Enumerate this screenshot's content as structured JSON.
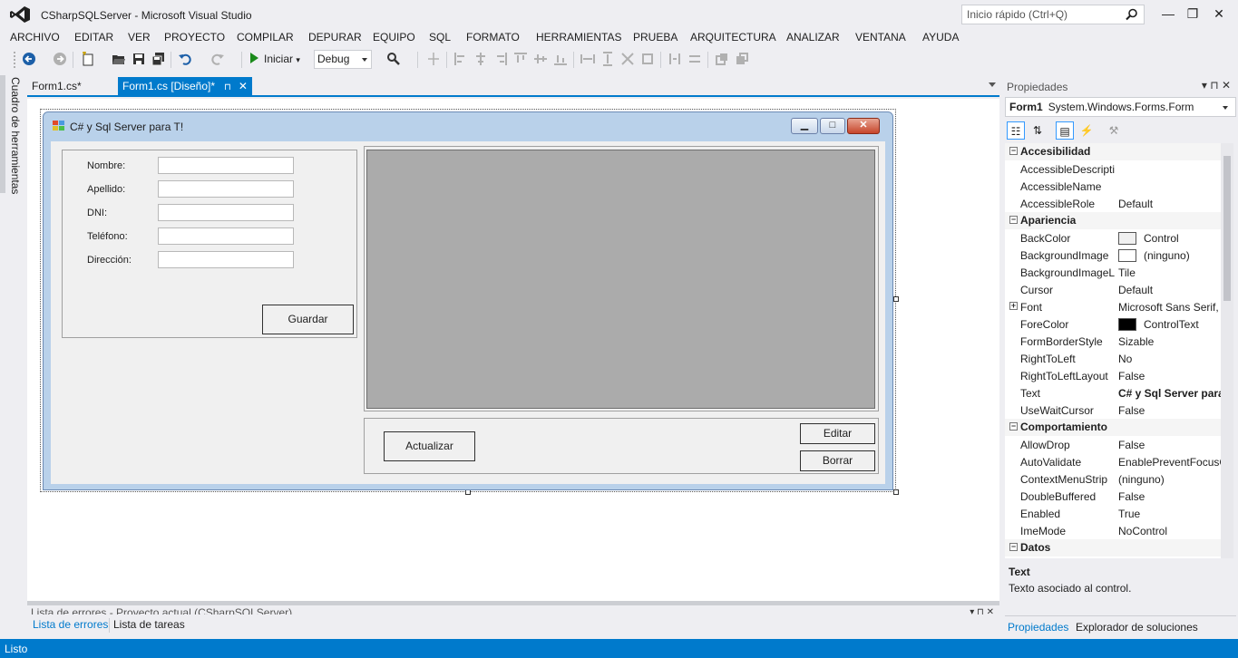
{
  "window": {
    "title": "CSharpSQLServer - Microsoft Visual Studio",
    "quick_launch_placeholder": "Inicio rápido (Ctrl+Q)",
    "minimize_label": "—",
    "restore_label": "❐",
    "close_label": "✕"
  },
  "menu": [
    "ARCHIVO",
    "EDITAR",
    "VER",
    "PROYECTO",
    "COMPILAR",
    "DEPURAR",
    "EQUIPO",
    "SQL",
    "FORMATO",
    "HERRAMIENTAS",
    "PRUEBA",
    "ARQUITECTURA",
    "ANALIZAR",
    "VENTANA",
    "AYUDA"
  ],
  "toolbar": {
    "start_label": "Iniciar",
    "configuration": "Debug"
  },
  "toolbox": {
    "label": "Cuadro de herramientas"
  },
  "doc_tabs": {
    "tab1": "Form1.cs*",
    "tab2": "Form1.cs [Diseño]*",
    "pin": "⊓",
    "close": "✕"
  },
  "form": {
    "title": "C# y Sql Server para T!",
    "min": "▁",
    "max": "□",
    "close": "✕",
    "labels": {
      "nombre": "Nombre:",
      "apellido": "Apellido:",
      "dni": "DNI:",
      "telefono": "Teléfono:",
      "direccion": "Dirección:"
    },
    "buttons": {
      "guardar": "Guardar",
      "actualizar": "Actualizar",
      "editar": "Editar",
      "borrar": "Borrar"
    }
  },
  "bottom_panel": {
    "title": "Lista de errores - Proyecto actual (CSharpSQLServer)",
    "buttons": "▾  ⊓  ✕",
    "tab1": "Lista de errores",
    "tab2": "Lista de tareas"
  },
  "properties": {
    "header": "Propiedades",
    "header_buttons": "▾  ⊓  ✕",
    "object_name": "Form1",
    "object_type": "System.Windows.Forms.Form",
    "rows": [
      {
        "type": "cat",
        "name": "Accesibilidad",
        "exp": "⊟"
      },
      {
        "type": "prop",
        "name": "AccessibleDescription",
        "value": ""
      },
      {
        "type": "prop",
        "name": "AccessibleName",
        "value": ""
      },
      {
        "type": "prop",
        "name": "AccessibleRole",
        "value": "Default"
      },
      {
        "type": "cat",
        "name": "Apariencia",
        "exp": "⊟"
      },
      {
        "type": "prop",
        "name": "BackColor",
        "value": "Control",
        "swatch": "#f0f0f0"
      },
      {
        "type": "prop",
        "name": "BackgroundImage",
        "value": "(ninguno)",
        "swatch": "#ffffff"
      },
      {
        "type": "prop",
        "name": "BackgroundImageLayout",
        "value": "Tile"
      },
      {
        "type": "prop",
        "name": "Cursor",
        "value": "Default"
      },
      {
        "type": "prop",
        "name": "Font",
        "value": "Microsoft Sans Serif,",
        "exp": "⊞"
      },
      {
        "type": "prop",
        "name": "ForeColor",
        "value": "ControlText",
        "swatch": "#000000"
      },
      {
        "type": "prop",
        "name": "FormBorderStyle",
        "value": "Sizable"
      },
      {
        "type": "prop",
        "name": "RightToLeft",
        "value": "No"
      },
      {
        "type": "prop",
        "name": "RightToLeftLayout",
        "value": "False"
      },
      {
        "type": "prop",
        "name": "Text",
        "value": "C# y Sql Server para",
        "bold": true
      },
      {
        "type": "prop",
        "name": "UseWaitCursor",
        "value": "False"
      },
      {
        "type": "cat",
        "name": "Comportamiento",
        "exp": "⊟"
      },
      {
        "type": "prop",
        "name": "AllowDrop",
        "value": "False"
      },
      {
        "type": "prop",
        "name": "AutoValidate",
        "value": "EnablePreventFocusChange"
      },
      {
        "type": "prop",
        "name": "ContextMenuStrip",
        "value": "(ninguno)"
      },
      {
        "type": "prop",
        "name": "DoubleBuffered",
        "value": "False"
      },
      {
        "type": "prop",
        "name": "Enabled",
        "value": "True"
      },
      {
        "type": "prop",
        "name": "ImeMode",
        "value": "NoControl"
      },
      {
        "type": "cat",
        "name": "Datos",
        "exp": "⊟"
      }
    ],
    "description_title": "Text",
    "description_text": "Texto asociado al control.",
    "tab1": "Propiedades",
    "tab2": "Explorador de soluciones"
  },
  "status": {
    "text": "Listo"
  },
  "colors": {
    "accent": "#007acc",
    "grid_gray": "#ababab",
    "form_border": "#b9d1ea"
  }
}
